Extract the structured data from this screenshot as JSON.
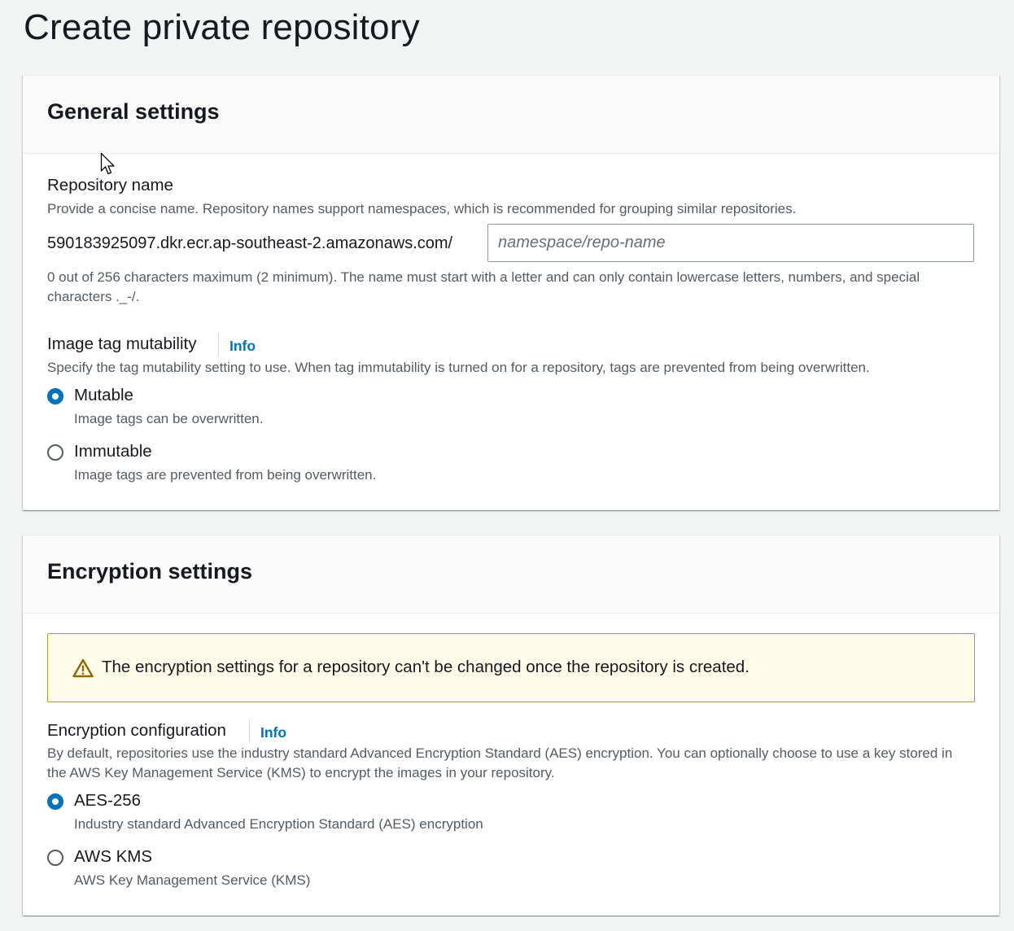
{
  "page": {
    "title": "Create private repository"
  },
  "general_settings": {
    "heading": "General settings",
    "repository_name": {
      "label": "Repository name",
      "description": "Provide a concise name. Repository names support namespaces, which is recommended for grouping similar repositories.",
      "prefix": "590183925097.dkr.ecr.ap-southeast-2.amazonaws.com/",
      "value": "",
      "placeholder": "namespace/repo-name",
      "constraint": "0 out of 256 characters maximum (2 minimum). The name must start with a letter and can only contain lowercase letters, numbers, and special characters ._-/."
    },
    "tag_mutability": {
      "label": "Image tag mutability",
      "info_label": "Info",
      "description": "Specify the tag mutability setting to use. When tag immutability is turned on for a repository, tags are prevented from being overwritten.",
      "options": [
        {
          "label": "Mutable",
          "description": "Image tags can be overwritten.",
          "selected": true
        },
        {
          "label": "Immutable",
          "description": "Image tags are prevented from being overwritten.",
          "selected": false
        }
      ]
    }
  },
  "encryption_settings": {
    "heading": "Encryption settings",
    "warning": "The encryption settings for a repository can't be changed once the repository is created.",
    "configuration": {
      "label": "Encryption configuration",
      "info_label": "Info",
      "description": "By default, repositories use the industry standard Advanced Encryption Standard (AES) encryption. You can optionally choose to use a key stored in the AWS Key Management Service (KMS) to encrypt the images in your repository.",
      "options": [
        {
          "label": "AES-256",
          "description": "Industry standard Advanced Encryption Standard (AES) encryption",
          "selected": true
        },
        {
          "label": "AWS KMS",
          "description": "AWS Key Management Service (KMS)",
          "selected": false
        }
      ]
    }
  },
  "colors": {
    "background": "#f2f3f3",
    "link": "#0073bb",
    "radio_selected": "#0073bb",
    "warning_background": "#fffce9",
    "warning_border": "#b59a31",
    "warning_icon": "#8d6605"
  },
  "icons": {
    "warning": "warning-icon",
    "cursor": "mouse-pointer-icon"
  }
}
